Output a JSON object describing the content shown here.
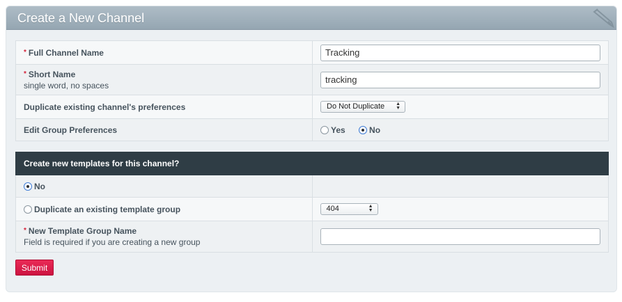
{
  "header": {
    "title": "Create a New Channel",
    "icon": "pencil-icon"
  },
  "channel_fields": {
    "full_name": {
      "label": "Full Channel Name",
      "value": "Tracking"
    },
    "short_name": {
      "label": "Short Name",
      "note": "single word, no spaces",
      "value": "tracking"
    },
    "duplicate_prefs": {
      "label": "Duplicate existing channel's preferences",
      "selected": "Do Not Duplicate"
    },
    "group_prefs": {
      "label": "Edit Group Preferences",
      "yes_label": "Yes",
      "no_label": "No",
      "selected": "No"
    }
  },
  "templates": {
    "heading": "Create new templates for this channel?",
    "no_label": "No",
    "duplicate_label": "Duplicate an existing template group",
    "duplicate_selected": "404",
    "selected": "No",
    "new_group": {
      "label": "New Template Group Name",
      "note": "Field is required if you are creating a new group",
      "value": ""
    }
  },
  "required_marker": "*",
  "submit_label": "Submit",
  "colors": {
    "header_bg": "#9fb0bb",
    "section_head": "#2f3d45",
    "submit": "#dc1e4a",
    "required": "#d3243b"
  }
}
